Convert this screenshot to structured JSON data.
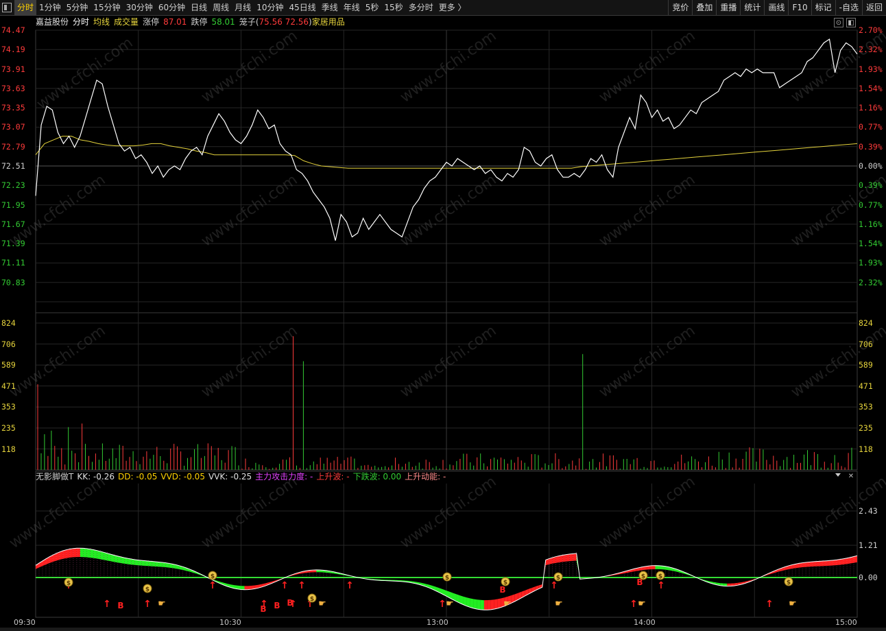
{
  "toolbar": {
    "tabs": [
      "分时",
      "1分钟",
      "5分钟",
      "15分钟",
      "30分钟",
      "60分钟",
      "日线",
      "周线",
      "月线",
      "10分钟",
      "45日线",
      "季线",
      "年线",
      "5秒",
      "15秒",
      "多分时",
      "更多 〉"
    ],
    "active_tab": 0,
    "tools": [
      "竞价",
      "叠加",
      "重播",
      "统计",
      "画线",
      "F10",
      "标记",
      "-自选",
      "返回"
    ]
  },
  "header": {
    "stock_name": "嘉益股份",
    "mode": "分时",
    "avg_line": "均线",
    "volume": "成交量",
    "limit_up_label": "涨停",
    "limit_up_value": "87.01",
    "limit_down_label": "跌停",
    "limit_down_value": "58.01",
    "cage_label": "笼子(",
    "cage_high": "75.56",
    "cage_low": "72.56",
    "cage_close": ")",
    "industry": "家居用品"
  },
  "indicator": {
    "name": "无影脚做T",
    "kk": "KK: -0.26",
    "dd": "DD: -0.05",
    "vvd": "VVD: -0.05",
    "vvk": "VVK: -0.25",
    "force": "主力攻击力度: -",
    "up_wave": "上升波: -",
    "down_wave": "下跌波: 0.00",
    "up_power": "上升动能: -"
  },
  "price_axis": {
    "left": [
      "74.47",
      "74.19",
      "73.91",
      "73.63",
      "73.35",
      "73.07",
      "72.79",
      "72.51",
      "72.23",
      "71.95",
      "71.67",
      "71.39",
      "71.11",
      "70.83"
    ],
    "right": [
      "2.70%",
      "2.32%",
      "1.93%",
      "1.54%",
      "1.16%",
      "0.77%",
      "0.39%",
      "0.00%",
      "0.39%",
      "0.77%",
      "1.16%",
      "1.54%",
      "1.93%",
      "2.32%"
    ],
    "prev_close": 72.51
  },
  "volume_axis": {
    "left": [
      "824",
      "706",
      "589",
      "471",
      "353",
      "235",
      "118"
    ],
    "right": [
      "824",
      "706",
      "589",
      "471",
      "353",
      "235",
      "118"
    ]
  },
  "ind_axis": {
    "right": [
      "2.43",
      "1.21",
      "0.00"
    ]
  },
  "times": [
    "09:30",
    "10:30",
    "13:00",
    "14:00",
    "15:00"
  ],
  "watermark": "www.cfchi.com",
  "colors": {
    "up": "#ff3b3b",
    "down": "#33cc33",
    "price": "#ffffff",
    "avg": "#e6d43c",
    "grid": "#2a2a2a",
    "magenta": "#e040fb",
    "yellow": "#ffd200"
  }
}
